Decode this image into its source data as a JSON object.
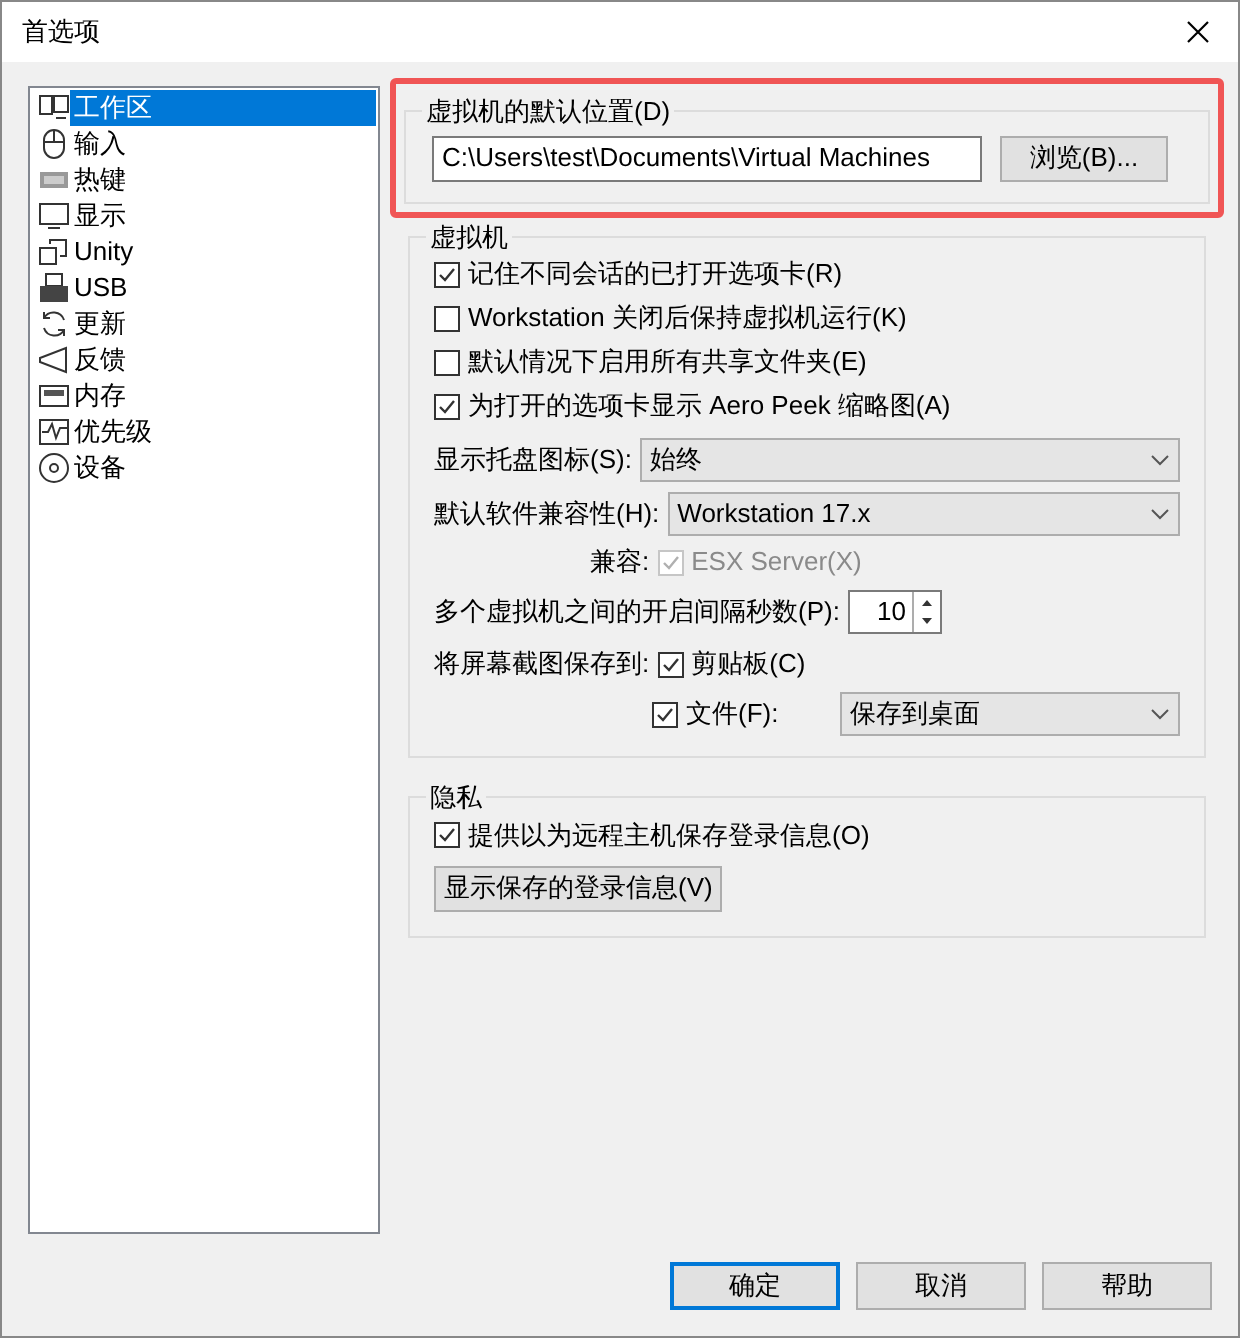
{
  "window": {
    "title": "首选项"
  },
  "sidebar": {
    "items": [
      {
        "label": "工作区",
        "selected": true
      },
      {
        "label": "输入",
        "selected": false
      },
      {
        "label": "热键",
        "selected": false
      },
      {
        "label": "显示",
        "selected": false
      },
      {
        "label": "Unity",
        "selected": false
      },
      {
        "label": "USB",
        "selected": false
      },
      {
        "label": "更新",
        "selected": false
      },
      {
        "label": "反馈",
        "selected": false
      },
      {
        "label": "内存",
        "selected": false
      },
      {
        "label": "优先级",
        "selected": false
      },
      {
        "label": "设备",
        "selected": false
      }
    ]
  },
  "location_group": {
    "title": "虚拟机的默认位置(D)",
    "highlighted": true,
    "path": "C:\\Users\\test\\Documents\\Virtual Machines",
    "browse_button": "浏览(B)..."
  },
  "vm_group": {
    "title": "虚拟机",
    "checkboxes": [
      {
        "label": "记住不同会话的已打开选项卡(R)",
        "checked": true
      },
      {
        "label": "Workstation 关闭后保持虚拟机运行(K)",
        "checked": false
      },
      {
        "label": "默认情况下启用所有共享文件夹(E)",
        "checked": false
      },
      {
        "label": "为打开的选项卡显示 Aero Peek 缩略图(A)",
        "checked": true
      }
    ],
    "tray_icon": {
      "label": "显示托盘图标(S):",
      "value": "始终"
    },
    "compatibility": {
      "label": "默认软件兼容性(H):",
      "value": "Workstation 17.x"
    },
    "compatible": {
      "label": "兼容:",
      "option": "ESX Server(X)",
      "checked": true,
      "disabled": true
    },
    "interval": {
      "label": "多个虚拟机之间的开启间隔秒数(P):",
      "value": "10"
    },
    "screenshot": {
      "label": "将屏幕截图保存到:",
      "clipboard": {
        "label": "剪贴板(C)",
        "checked": true
      },
      "file": {
        "label": "文件(F):",
        "checked": true,
        "destination": "保存到桌面"
      }
    }
  },
  "privacy_group": {
    "title": "隐私",
    "checkbox": {
      "label": "提供以为远程主机保存登录信息(O)",
      "checked": true
    },
    "button": "显示保存的登录信息(V)"
  },
  "buttons": [
    {
      "label": "确定",
      "default": true
    },
    {
      "label": "取消",
      "default": false
    },
    {
      "label": "帮助",
      "default": false
    }
  ]
}
